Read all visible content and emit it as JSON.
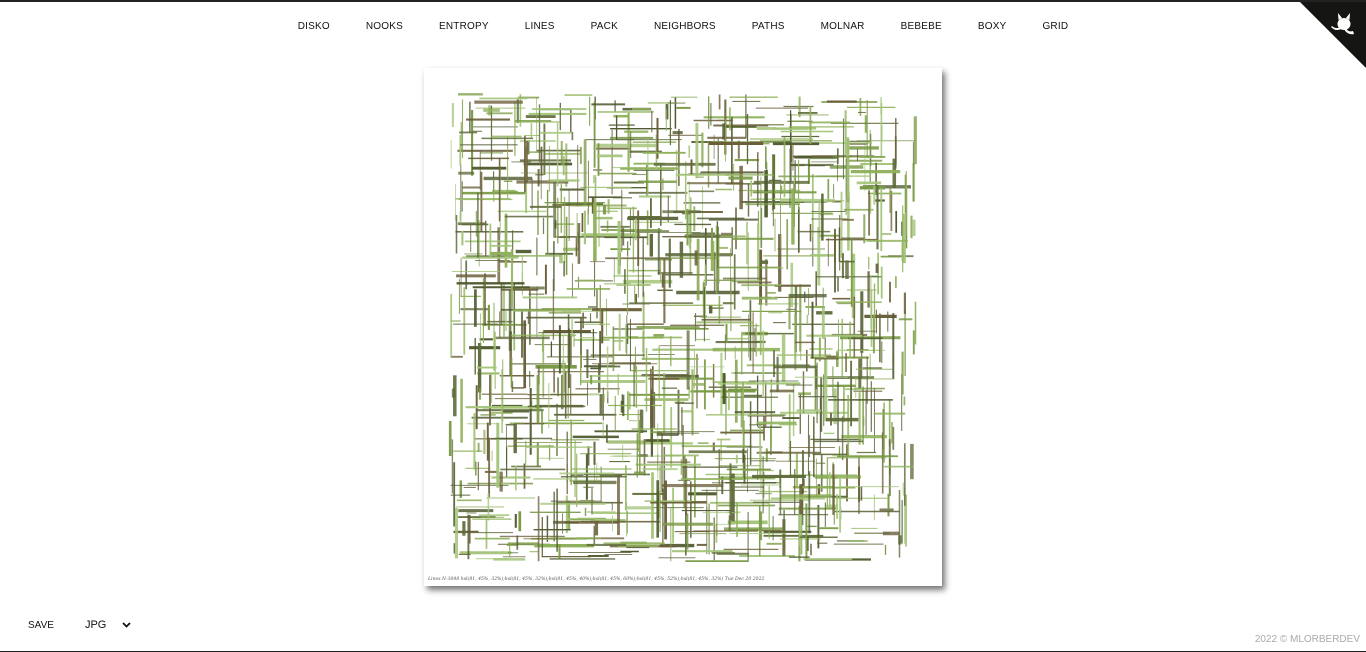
{
  "nav": {
    "items": [
      "DISKO",
      "NOOKS",
      "ENTROPY",
      "LINES",
      "PACK",
      "NEIGHBORS",
      "PATHS",
      "MOLNAR",
      "BEBEBE",
      "BOXY",
      "GRID"
    ]
  },
  "corner_icon": "github-octocat-icon",
  "artwork": {
    "caption": "Lines N-3048 hsl(81, 45%, 32%);hsl(81, 45%, 32%);hsl(81, 45%, 40%);hsl(81, 45%, 60%);hsl(81, 45%, 52%);hsl(81, 45%, 32%) Tue Dec 20 2022",
    "colors": [
      "#5f6b3a",
      "#6b5f3a",
      "#7a9a45",
      "#8fb15a",
      "#a4c57a",
      "#4f5a2f"
    ]
  },
  "controls": {
    "save_label": "SAVE",
    "format_selected": "JPG",
    "chevron_icon": "chevron-down-icon"
  },
  "footer": {
    "text": "2022 © MLORBERDEV"
  },
  "colors": {
    "border": "#222222",
    "footer_text": "#aaaaaa"
  }
}
